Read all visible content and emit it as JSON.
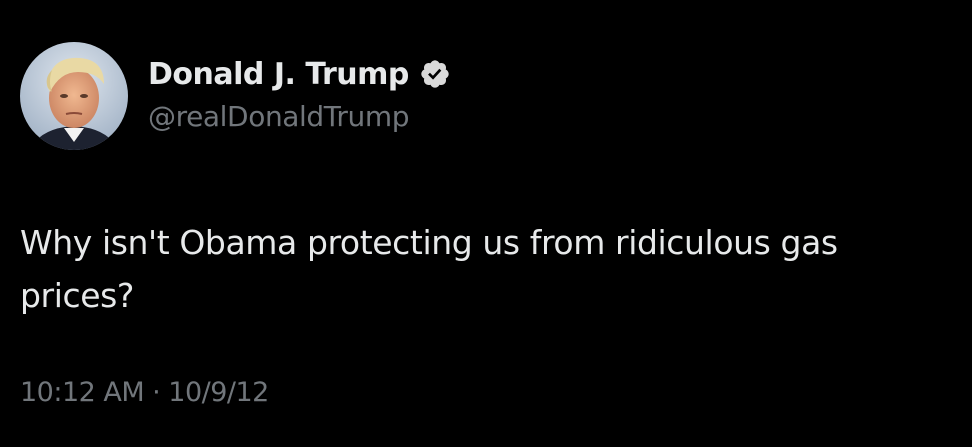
{
  "tweet": {
    "author": {
      "display_name": "Donald J. Trump",
      "handle": "@realDonaldTrump",
      "verified": true,
      "verified_icon": "verified-badge-icon",
      "avatar_icon": "profile-photo"
    },
    "text": "Why isn't Obama protecting us from ridiculous gas prices?",
    "time": "10:12 AM",
    "separator": "·",
    "date": "10/9/12"
  },
  "colors": {
    "background": "#000000",
    "primary_text": "#e7e9ea",
    "secondary_text": "#71767b",
    "badge": "#d9d9d9"
  }
}
